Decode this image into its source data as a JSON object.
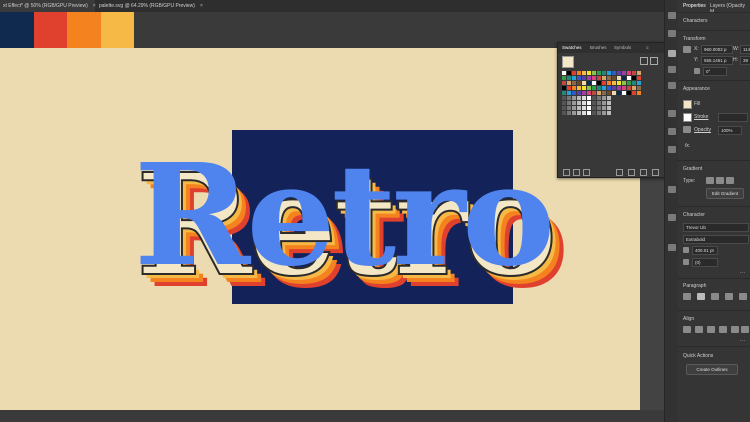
{
  "tabs": [
    {
      "label": "xt Effect* @ 50% (RGB/GPU Preview)",
      "active": true
    },
    {
      "label": "palette.svg @ 64.29% (RGB/GPU Preview)",
      "active": false
    }
  ],
  "palette": {
    "colors": [
      "#102a4f",
      "#e0402e",
      "#f3821f",
      "#f7b946"
    ]
  },
  "artwork": {
    "word": "Retro",
    "text_color": "#4f84ef",
    "shadow_colors": [
      "#2d4fa8",
      "#2b8fd0",
      "#8fd0e0",
      "#f7b946",
      "#f3821f",
      "#e0402e"
    ]
  },
  "swatches_panel": {
    "tabs": [
      "Swatches",
      "Brushes",
      "Symbols"
    ]
  },
  "properties_panel": {
    "tabs": [
      "Properties",
      "Layers (Opacity M"
    ],
    "selection_label": "Characters",
    "transform": {
      "heading": "Transform",
      "x_label": "X:",
      "x_value": "960.0002 p",
      "y_label": "Y:",
      "y_value": "555.1451 p",
      "w_label": "W:",
      "w_value": "114",
      "h_label": "H:",
      "h_value": "39",
      "angle": "0°"
    },
    "appearance": {
      "heading": "Appearance",
      "fill_label": "Fill",
      "stroke_label": "Stroke",
      "opacity_label": "Opacity",
      "opacity_value": "100%",
      "fx_label": "fx."
    },
    "gradient": {
      "heading": "Gradient",
      "type_label": "Type:",
      "edit_button": "Edit Gradient"
    },
    "character": {
      "heading": "Character",
      "font_family": "Trevor Ub",
      "font_style": "Extrabold",
      "size_value": "400.01 pt",
      "leading_value": "(0)"
    },
    "paragraph": {
      "heading": "Paragraph"
    },
    "align": {
      "heading": "Align"
    },
    "quick_actions": {
      "heading": "Quick Actions",
      "create_outlines": "Create Outlines"
    }
  }
}
